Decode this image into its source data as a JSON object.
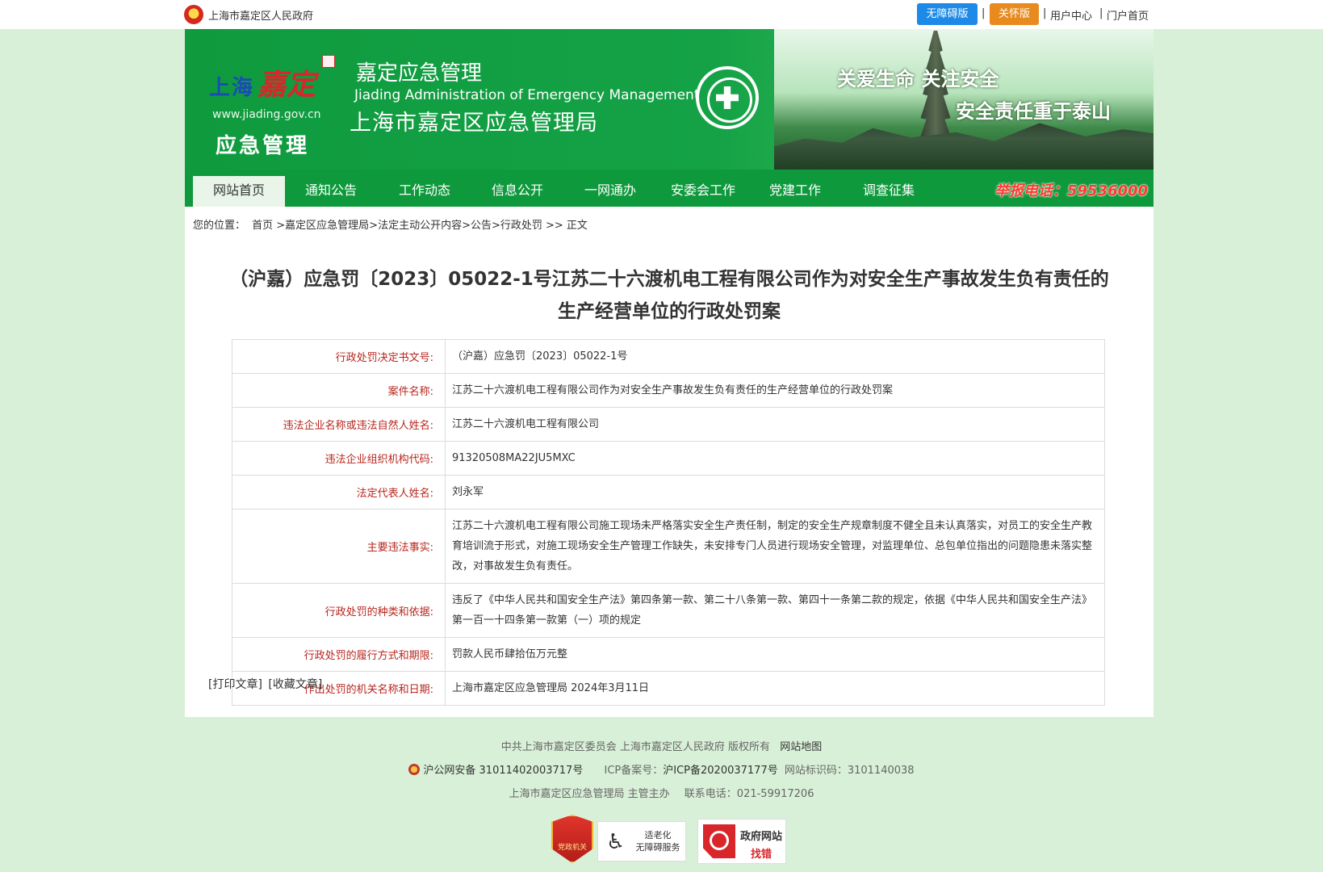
{
  "topbar": {
    "gov_name": "上海市嘉定区人民政府",
    "accessible_label": "无障碍版",
    "care_label": "关怀版",
    "user_center": "用户中心",
    "portal_home": "门户首页",
    "separator": "|"
  },
  "banner": {
    "logo_shanghai": "上海",
    "logo_jiading": "嘉定",
    "logo_url": "www.jiading.gov.cn",
    "logo_tag": "应急管理",
    "title_cn": "嘉定应急管理",
    "title_en": "Jiading Administration of Emergency Management",
    "title_full": "上海市嘉定区应急管理局",
    "slogan1": "关爱生命  关注安全",
    "slogan2": "安全责任重于泰山"
  },
  "nav": {
    "items": [
      {
        "label": "网站首页"
      },
      {
        "label": "通知公告"
      },
      {
        "label": "工作动态"
      },
      {
        "label": "信息公开"
      },
      {
        "label": "一网通办"
      },
      {
        "label": "安委会工作"
      },
      {
        "label": "党建工作"
      },
      {
        "label": "调查征集"
      }
    ],
    "hotline": "举报电话：59536000"
  },
  "breadcrumb": {
    "prefix": "您的位置：",
    "path": "首页 >嘉定区应急管理局>法定主动公开内容>公告>行政处罚 >> 正文"
  },
  "article": {
    "title_line1": "（沪嘉）应急罚〔2023〕05022-1号江苏二十六渡机电工程有限公司作为对安全生产事故发生负有责任的",
    "title_line2": "生产经营单位的行政处罚案"
  },
  "info_rows": [
    {
      "label": "行政处罚决定书文号:",
      "value": "（沪嘉）应急罚〔2023〕05022-1号"
    },
    {
      "label": "案件名称:",
      "value": "江苏二十六渡机电工程有限公司作为对安全生产事故发生负有责任的生产经营单位的行政处罚案"
    },
    {
      "label": "违法企业名称或违法自然人姓名:",
      "value": "江苏二十六渡机电工程有限公司"
    },
    {
      "label": "违法企业组织机构代码:",
      "value": "91320508MA22JU5MXC"
    },
    {
      "label": "法定代表人姓名:",
      "value": "刘永军"
    },
    {
      "label": "主要违法事实:",
      "value": "江苏二十六渡机电工程有限公司施工现场未严格落实安全生产责任制，制定的安全生产规章制度不健全且未认真落实，对员工的安全生产教育培训流于形式，对施工现场安全生产管理工作缺失，未安排专门人员进行现场安全管理，对监理单位、总包单位指出的问题隐患未落实整改，对事故发生负有责任。"
    },
    {
      "label": "行政处罚的种类和依据:",
      "value": "违反了《中华人民共和国安全生产法》第四条第一款、第二十八条第一款、第四十一条第二款的规定，依据《中华人民共和国安全生产法》第一百一十四条第一款第（一）项的规定"
    },
    {
      "label": "行政处罚的履行方式和期限:",
      "value": "罚款人民币肆拾伍万元整"
    },
    {
      "label": "作出处罚的机关名称和日期:",
      "value": "上海市嘉定区应急管理局 2024年3月11日"
    }
  ],
  "actions": {
    "print": "[打印文章]",
    "favorite": "[收藏文章]"
  },
  "footer": {
    "copyright": "中共上海市嘉定区委员会 上海市嘉定区人民政府 版权所有",
    "sitemap": "网站地图",
    "police_record": "沪公网安备 31011402003717号",
    "icp_label": "ICP备案号：",
    "icp_value": "沪ICP备2020037177号",
    "site_id": "网站标识码：3101140038",
    "host": "上海市嘉定区应急管理局 主管主办",
    "phone": "联系电话：021-59917206",
    "badge_party": "党政机关",
    "badge_elder_line1": "适老化",
    "badge_elder_line2": "无障碍服务",
    "badge_error_line1": "政府网站",
    "badge_error_line2": "找错"
  }
}
